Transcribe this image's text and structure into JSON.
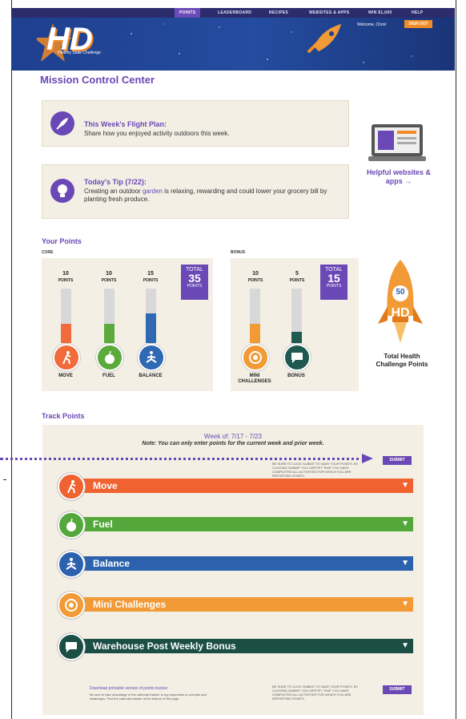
{
  "nav": {
    "items": [
      {
        "label": "POINTS"
      },
      {
        "label": "LEADERBOARD"
      },
      {
        "label": "RECIPES"
      },
      {
        "label": "WEBSITES & APPS"
      },
      {
        "label": "WIN $1,000"
      },
      {
        "label": "HELP"
      }
    ],
    "active_index": 0
  },
  "header": {
    "logo_text": "HD",
    "logo_sub": "Healthy State Challenge",
    "welcome": "Welcome, Chris!",
    "signout": "SIGN OUT"
  },
  "page_title": "Mission Control Center",
  "flight_plan": {
    "title": "This Week's Flight Plan:",
    "body": "Share how you enjoyed activity outdoors this week."
  },
  "tip": {
    "title": "Today's Tip (7/22):",
    "body_before": "Creating an outdoor",
    "body_link": "garden",
    "body_after": "is relaxing, rewarding and could lower your grocery bill by planting fresh produce."
  },
  "helpful_links": "Helpful websites & apps →",
  "your_points": {
    "heading": "Your Points",
    "core_label": "CORE",
    "bonus_label": "BONUS",
    "unit": "POINTS",
    "total_label": "TOTAL",
    "core": [
      {
        "name": "MOVE",
        "points": "10",
        "level": 0.35,
        "color": "#f26b3a"
      },
      {
        "name": "FUEL",
        "points": "10",
        "level": 0.35,
        "color": "#5aab3c"
      },
      {
        "name": "BALANCE",
        "points": "15",
        "level": 0.55,
        "color": "#2f68b3"
      }
    ],
    "core_total": "35",
    "bonus": [
      {
        "name": "MINI CHALLENGES",
        "points": "10",
        "level": 0.35,
        "color": "#f29a35"
      },
      {
        "name": "BONUS",
        "points": "5",
        "level": 0.2,
        "color": "#1e5a4f"
      }
    ],
    "bonus_total": "15"
  },
  "rocket": {
    "points": "50",
    "badge": "HD",
    "label": "Total Health Challenge Points"
  },
  "track": {
    "heading": "Track Points",
    "week": "Week of: 7/17 - 7/23",
    "note": "Note: You can only enter points for the current week and prior week.",
    "fineprint": "BE SURE TO CLICK SUBMIT TO SAVE YOUR POINTS. BY CLICKING SUBMIT YOU CERTIFY THAT YOU HAVE COMPLETED ALL ACTIVITIES FOR WHICH YOU ARE REPORTING POINTS.",
    "submit": "SUBMIT",
    "categories": [
      {
        "label": "Move",
        "color": "#f0622f"
      },
      {
        "label": "Fuel",
        "color": "#54a83b"
      },
      {
        "label": "Balance",
        "color": "#2c62ad"
      },
      {
        "label": "Mini Challenges",
        "color": "#f29a35"
      },
      {
        "label": "Warehouse Post Weekly Bonus",
        "color": "#1b4f46"
      }
    ],
    "footer_link": "Download printable version of points tracker",
    "footer_text": "Be sure to take advantage of the calendar tracker to log responses to prompts and challenges. Find the calendar tracker at the bottom of the page."
  }
}
